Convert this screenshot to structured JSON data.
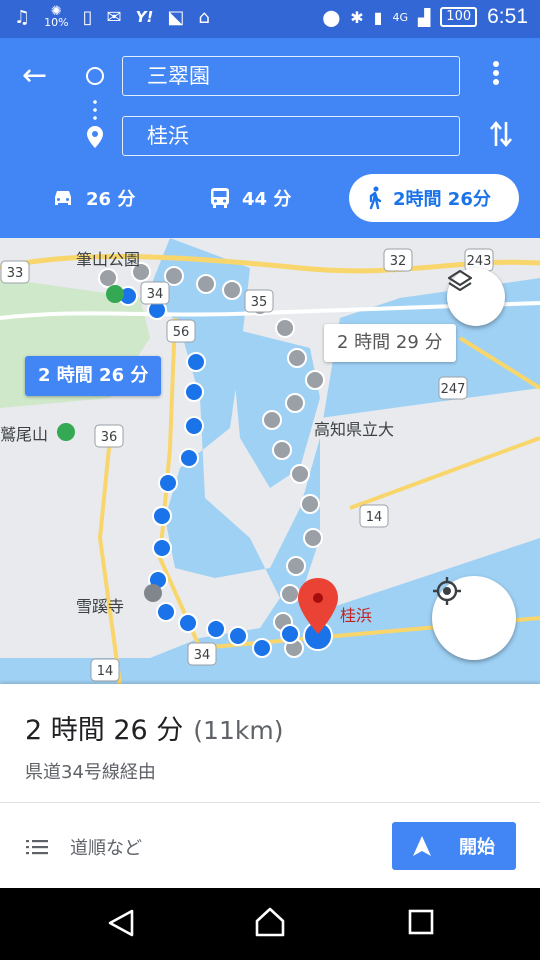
{
  "status_bar": {
    "signal_small": "10%",
    "network": "4G",
    "battery": "100",
    "time": "6:51"
  },
  "header": {
    "origin": "三翠園",
    "destination": "桂浜",
    "modes": [
      {
        "icon": "car-icon",
        "label": "26 分"
      },
      {
        "icon": "bus-icon",
        "label": "44 分"
      },
      {
        "icon": "walk-icon",
        "label": "2時間 26分",
        "selected": true
      }
    ]
  },
  "map": {
    "route_label": "2 時間 26 分",
    "alt_route_label": "2 時間 29 分",
    "places": {
      "park": "筆山公園",
      "mountain": "鷲尾山",
      "university": "高知県立大",
      "temple": "雪蹊寺",
      "destination": "桂浜"
    },
    "road_shields": [
      "33",
      "34",
      "56",
      "35",
      "32",
      "243",
      "36",
      "247",
      "14",
      "14",
      "34"
    ],
    "route_color": "#1a73e8",
    "alt_route_color": "#9aa0a6",
    "destination_pin_color": "#ea4335"
  },
  "sheet": {
    "duration": "2 時間 26 分",
    "distance": "(11km)",
    "via": "県道34号線経由",
    "steps_label": "道順など",
    "start_label": "開始"
  },
  "colors": {
    "header": "#4285f4",
    "status_bar": "#3367d6",
    "accent": "#1a73e8"
  }
}
